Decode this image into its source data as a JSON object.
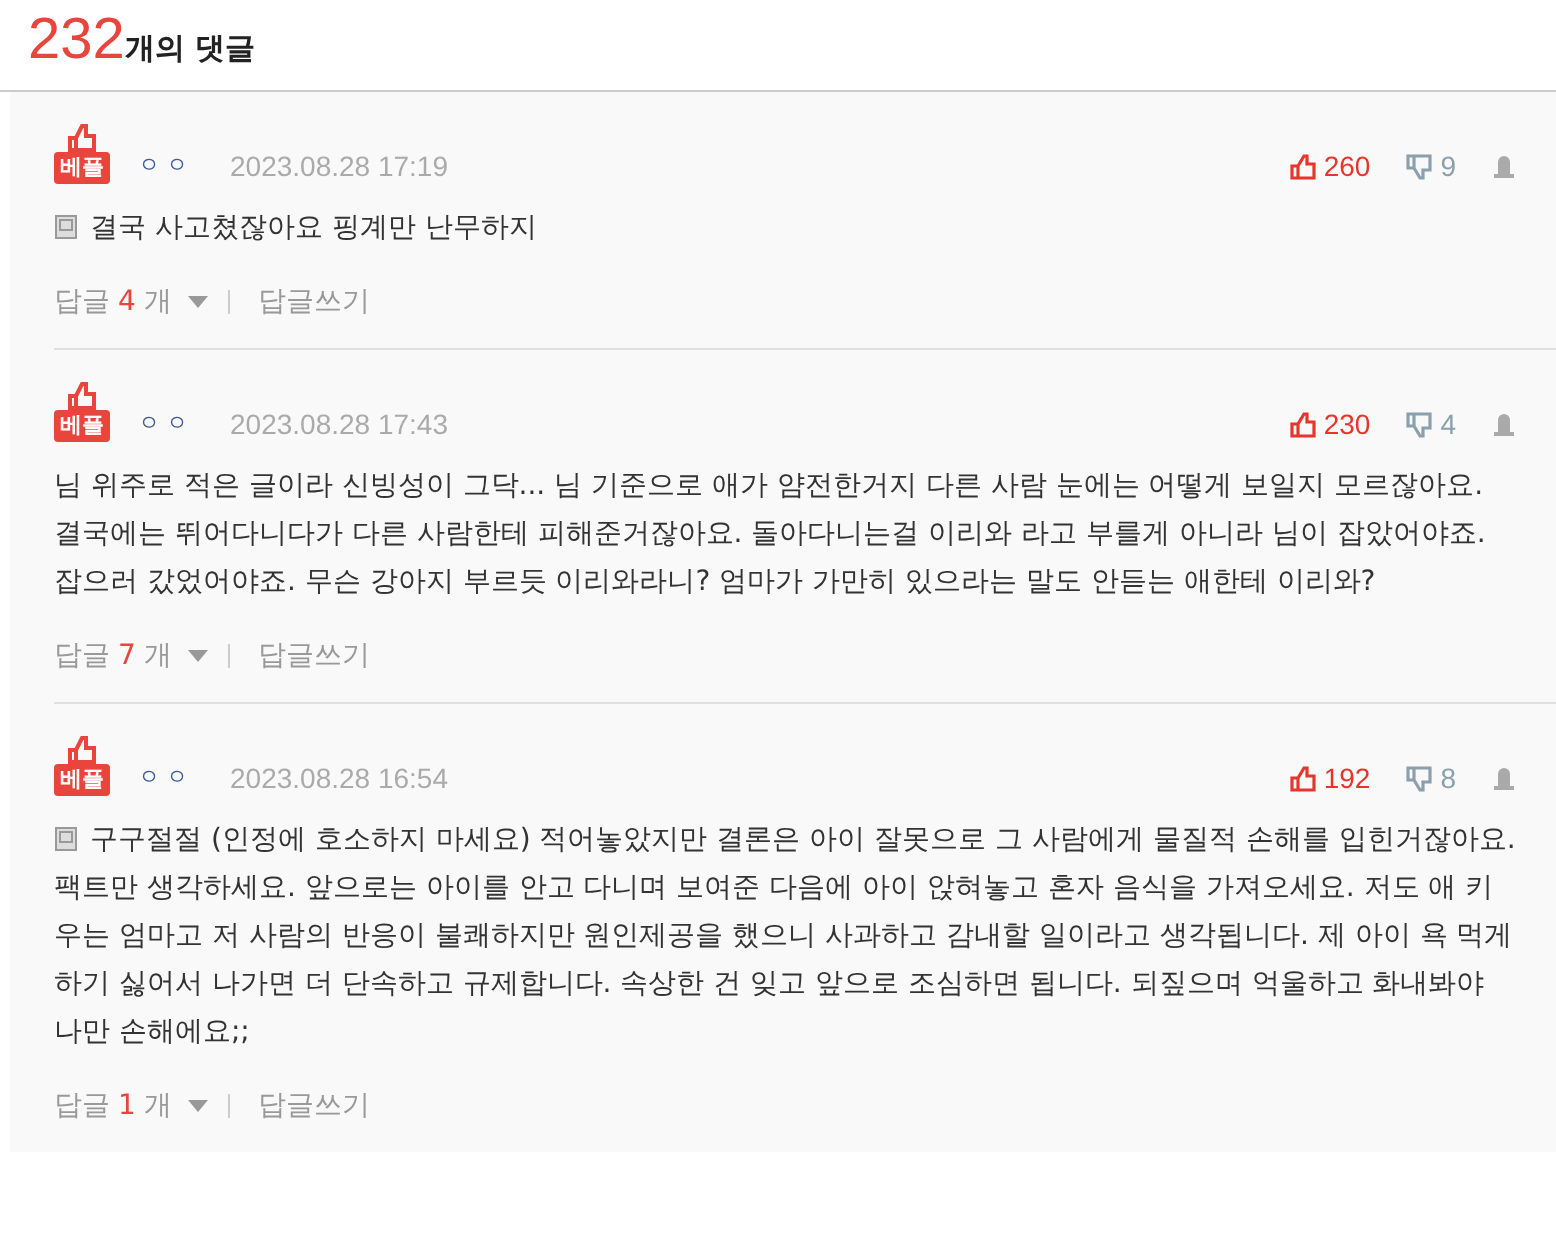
{
  "header": {
    "count": "232",
    "label": "개의 댓글"
  },
  "comments": [
    {
      "badge": "베플",
      "author": "ㅇㅇ",
      "date": "2023.08.28 17:19",
      "likes": "260",
      "dislikes": "9",
      "kind": "memo",
      "text": "결국 사고쳤잖아요 핑계만 난무하지",
      "replies": {
        "label": "답글",
        "count": "4",
        "unit": "개"
      },
      "write": "답글쓰기"
    },
    {
      "badge": "베플",
      "author": "ㅇㅇ",
      "date": "2023.08.28 17:43",
      "likes": "230",
      "dislikes": "4",
      "kind": "plain",
      "text": "님 위주로 적은 글이라 신빙성이 그닥... 님 기준으로 애가 얌전한거지 다른 사람 눈에는 어떻게 보일지 모르잖아요. 결국에는 뛰어다니다가 다른 사람한테 피해준거잖아요. 돌아다니는걸 이리와 라고 부를게 아니라 님이 잡았어야죠. 잡으러 갔었어야죠. 무슨 강아지 부르듯 이리와라니? 엄마가 가만히 있으라는 말도 안듣는 애한테 이리와?",
      "replies": {
        "label": "답글",
        "count": "7",
        "unit": "개"
      },
      "write": "답글쓰기"
    },
    {
      "badge": "베플",
      "author": "ㅇㅇ",
      "date": "2023.08.28 16:54",
      "likes": "192",
      "dislikes": "8",
      "kind": "memo",
      "text": "구구절절 (인정에 호소하지 마세요) 적어놓았지만 결론은 아이 잘못으로 그 사람에게 물질적 손해를 입힌거잖아요. 팩트만 생각하세요. 앞으로는 아이를 안고 다니며 보여준 다음에 아이 앉혀놓고 혼자 음식을 가져오세요. 저도 애 키우는 엄마고 저 사람의 반응이 불쾌하지만 원인제공을 했으니 사과하고 감내할 일이라고 생각됩니다. 제 아이 욕 먹게 하기 싫어서 나가면 더 단속하고 규제합니다. 속상한 건 잊고 앞으로 조심하면 됩니다. 되짚으며 억울하고 화내봐야 나만 손해에요;;",
      "replies": {
        "label": "답글",
        "count": "1",
        "unit": "개"
      },
      "write": "답글쓰기"
    }
  ]
}
